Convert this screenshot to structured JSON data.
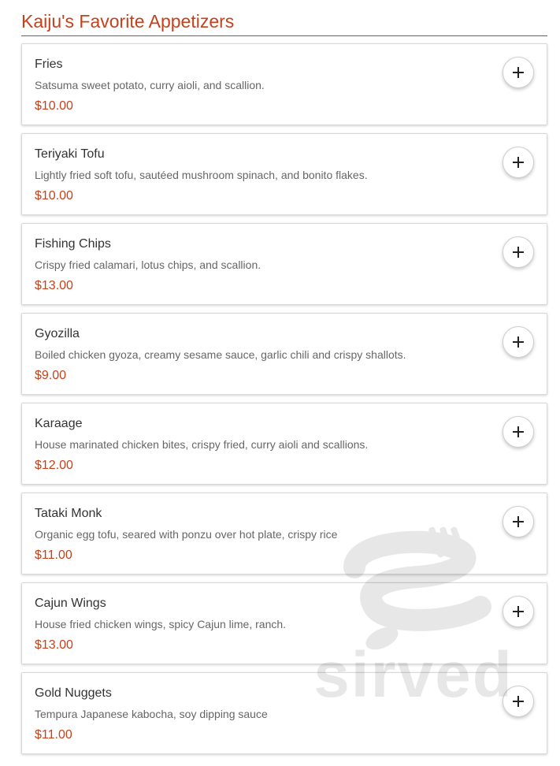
{
  "section": {
    "title": "Kaiju's Favorite Appetizers"
  },
  "items": [
    {
      "name": "Fries",
      "description": "Satsuma sweet potato, curry aioli, and scallion.",
      "price": "$10.00"
    },
    {
      "name": "Teriyaki Tofu",
      "description": "Lightly fried soft tofu, sautéed mushroom spinach, and bonito flakes.",
      "price": "$10.00"
    },
    {
      "name": "Fishing Chips",
      "description": "Crispy fried calamari, lotus chips, and scallion.",
      "price": "$13.00"
    },
    {
      "name": "Gyozilla",
      "description": "Boiled chicken gyoza, creamy sesame sauce, garlic chili and crispy shallots.",
      "price": "$9.00"
    },
    {
      "name": "Karaage",
      "description": "House marinated chicken bites, crispy fried, curry aioli and scallions.",
      "price": "$12.00"
    },
    {
      "name": "Tataki Monk",
      "description": "Organic egg tofu, seared with ponzu over hot plate, crispy rice",
      "price": "$11.00"
    },
    {
      "name": "Cajun Wings",
      "description": "House fried chicken wings, spicy Cajun lime, ranch.",
      "price": "$13.00"
    },
    {
      "name": "Gold Nuggets",
      "description": "Tempura Japanese kabocha, soy dipping sauce",
      "price": "$11.00"
    }
  ],
  "add_button_icon": "plus-icon",
  "watermark": {
    "text": "sirved",
    "icon": "fork-spoon-logo-icon"
  },
  "colors": {
    "accent": "#c5411b",
    "name_text": "#333333",
    "description_text": "#666666"
  }
}
